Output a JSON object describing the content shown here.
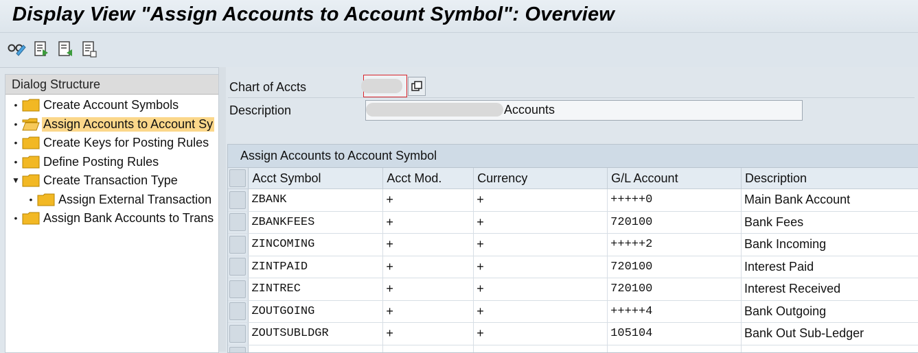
{
  "window": {
    "title": "Display View \"Assign Accounts to Account Symbol\": Overview"
  },
  "toolbar": {
    "icons": [
      "glasses-icon",
      "prev-entry-icon",
      "next-entry-icon",
      "document-icon"
    ]
  },
  "dialog_structure": {
    "header": "Dialog Structure",
    "items": [
      {
        "label": "Create Account Symbols",
        "level": 0,
        "selected": false,
        "expanded": false
      },
      {
        "label": "Assign Accounts to Account Sy",
        "level": 0,
        "selected": true,
        "expanded": false
      },
      {
        "label": "Create Keys for Posting Rules",
        "level": 0,
        "selected": false,
        "expanded": false
      },
      {
        "label": "Define Posting Rules",
        "level": 0,
        "selected": false,
        "expanded": false
      },
      {
        "label": "Create Transaction Type",
        "level": 0,
        "selected": false,
        "expanded": true
      },
      {
        "label": "Assign External Transaction",
        "level": 1,
        "selected": false,
        "expanded": false
      },
      {
        "label": "Assign Bank Accounts to Trans",
        "level": 0,
        "selected": false,
        "expanded": false
      }
    ]
  },
  "header": {
    "chart_of_accts_label": "Chart of Accts",
    "description_label": "Description",
    "description_value": "Accounts"
  },
  "table": {
    "title": "Assign Accounts to Account Symbol",
    "columns": [
      "Acct Symbol",
      "Acct Mod.",
      "Currency",
      "G/L Account",
      "Description"
    ],
    "rows": [
      [
        "ZBANK",
        "+",
        "+",
        "+++++0",
        "Main Bank Account"
      ],
      [
        "ZBANKFEES",
        "+",
        "+",
        "720100",
        "Bank Fees"
      ],
      [
        "ZINCOMING",
        "+",
        "+",
        "+++++2",
        "Bank Incoming"
      ],
      [
        "ZINTPAID",
        "+",
        "+",
        "720100",
        "Interest Paid"
      ],
      [
        "ZINTREC",
        "+",
        "+",
        "720100",
        "Interest Received"
      ],
      [
        "ZOUTGOING",
        "+",
        "+",
        "+++++4",
        "Bank Outgoing"
      ],
      [
        "ZOUTSUBLDGR",
        "+",
        "+",
        "105104",
        "Bank Out Sub-Ledger"
      ]
    ]
  },
  "colors": {
    "selected_item": "#fbd78a",
    "folder": "#f2b824",
    "accent_border": "#d9232a"
  }
}
